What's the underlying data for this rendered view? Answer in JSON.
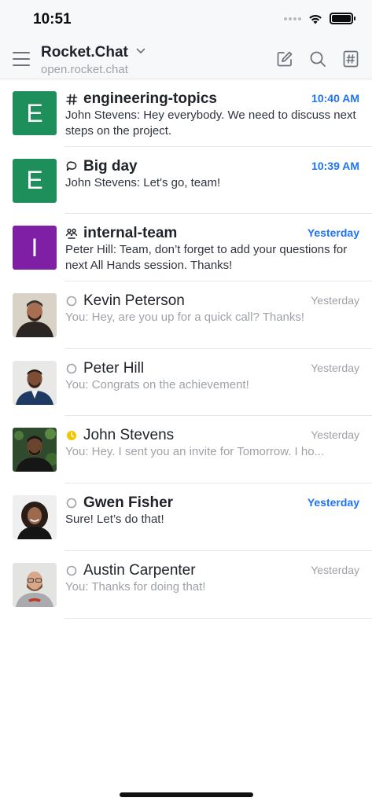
{
  "status_bar": {
    "time": "10:51"
  },
  "header": {
    "server_name": "Rocket.Chat",
    "server_url": "open.rocket.chat",
    "icons": [
      "menu-icon",
      "chevron-down-icon",
      "compose-icon",
      "search-icon",
      "directory-icon"
    ]
  },
  "colors": {
    "accent": "#1d74f5",
    "avatar_green": "#1e8e5a",
    "avatar_purple": "#7e1fa5",
    "status_away": "#f5c400"
  },
  "rooms": [
    {
      "name": "engineering-topics",
      "type": "channel",
      "time": "10:40 AM",
      "unread": true,
      "message": "John Stevens: Hey everybody. We need to discuss next steps on the project.",
      "avatar": "E"
    },
    {
      "name": "Big day",
      "type": "discussion",
      "time": "10:39 AM",
      "unread": true,
      "message": "John Stevens: Let's go, team!",
      "avatar": "E"
    },
    {
      "name": "internal-team",
      "type": "team",
      "time": "Yesterday",
      "unread": true,
      "message": "Peter Hill: Team, don’t forget to add your questions for next All Hands session. Thanks!",
      "avatar": "I"
    },
    {
      "name": "Kevin Peterson",
      "type": "dm",
      "status": "offline",
      "time": "Yesterday",
      "unread": false,
      "message": "You: Hey, are you up for a quick call? Thanks!"
    },
    {
      "name": "Peter Hill",
      "type": "dm",
      "status": "offline",
      "time": "Yesterday",
      "unread": false,
      "message": "You: Congrats on the achievement!"
    },
    {
      "name": "John Stevens",
      "type": "dm",
      "status": "away",
      "time": "Yesterday",
      "unread": false,
      "message": "You: Hey. I sent you an invite for Tomorrow. I ho..."
    },
    {
      "name": "Gwen Fisher",
      "type": "dm",
      "status": "offline",
      "time": "Yesterday",
      "unread": true,
      "message": "Sure! Let’s do that!"
    },
    {
      "name": "Austin Carpenter",
      "type": "dm",
      "status": "offline",
      "time": "Yesterday",
      "unread": false,
      "message": "You: Thanks for doing that!"
    }
  ]
}
